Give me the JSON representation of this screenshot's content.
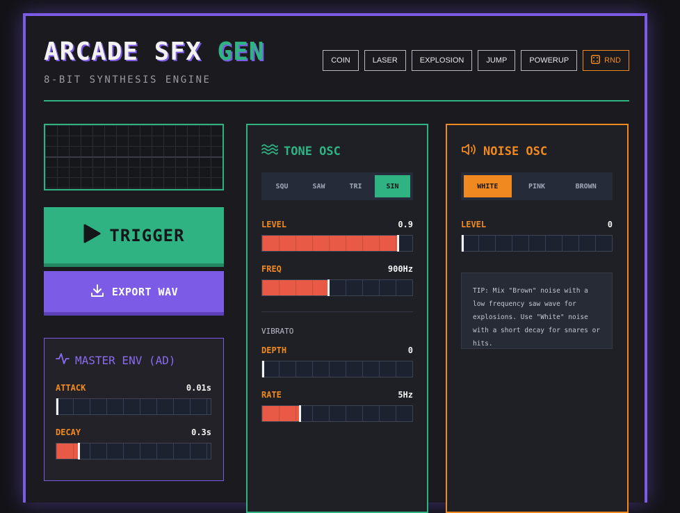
{
  "header": {
    "title_main": "ARCADE SFX",
    "title_accent": "GEN",
    "subtitle": "8-BIT SYNTHESIS ENGINE"
  },
  "presets": [
    "COIN",
    "LASER",
    "EXPLOSION",
    "JUMP",
    "POWERUP"
  ],
  "random_label": "RND",
  "actions": {
    "trigger_label": "TRIGGER",
    "export_label": "EXPORT WAV"
  },
  "envelope": {
    "title": "MASTER ENV (AD)",
    "attack": {
      "label": "ATTACK",
      "value": "0.01s",
      "level": 0
    },
    "decay": {
      "label": "DECAY",
      "value": "0.3s",
      "level": 0.14
    }
  },
  "tone": {
    "title": "TONE OSC",
    "waveforms": [
      "SQU",
      "SAW",
      "TRI",
      "SIN"
    ],
    "selected_waveform": "SIN",
    "level": {
      "label": "LEVEL",
      "value": "0.9",
      "level": 0.9
    },
    "freq": {
      "label": "FREQ",
      "value": "900Hz",
      "level": 0.435
    },
    "vibrato_label": "VIBRATO",
    "depth": {
      "label": "DEPTH",
      "value": "0",
      "level": 0
    },
    "rate": {
      "label": "RATE",
      "value": "5Hz",
      "level": 0.245
    }
  },
  "noise": {
    "title": "NOISE OSC",
    "types": [
      "WHITE",
      "PINK",
      "BROWN"
    ],
    "selected_type": "WHITE",
    "level": {
      "label": "LEVEL",
      "value": "0",
      "level": 0
    },
    "tip": "TIP: Mix \"Brown\" noise with a low frequency saw wave for explosions. Use \"White\" noise with a short decay for snares or hits."
  },
  "colors": {
    "accent_purple": "#7c5ce6",
    "accent_green": "#2fb383",
    "accent_orange": "#f08a20",
    "slider_fill": "#e85a45",
    "background": "#1b1b1f"
  }
}
